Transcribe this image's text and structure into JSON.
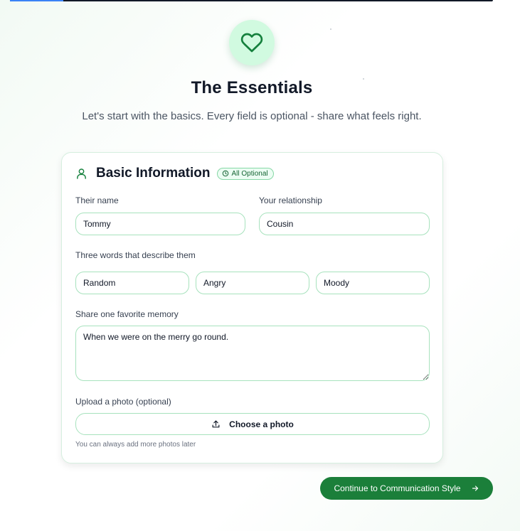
{
  "progress": {
    "fraction": 0.11
  },
  "header": {
    "icon": "heart-icon",
    "title": "The Essentials",
    "subtitle": "Let's start with the basics. Every field is optional - share what feels right."
  },
  "card": {
    "icon": "user-icon",
    "title": "Basic Information",
    "badge": "All Optional",
    "badge_icon": "clock-icon",
    "fields": {
      "name": {
        "label": "Their name",
        "value": "Tommy"
      },
      "relationship": {
        "label": "Your relationship",
        "value": "Cousin"
      },
      "words": {
        "label": "Three words that describe them",
        "values": [
          "Random",
          "Angry",
          "Moody"
        ]
      },
      "memory": {
        "label": "Share one favorite memory",
        "value": "When we were on the merry go round."
      },
      "photo": {
        "label": "Upload a photo (optional)",
        "button": "Choose a photo",
        "icon": "upload-icon",
        "hint": "You can always add more photos later"
      }
    }
  },
  "footer": {
    "continue_label": "Continue to Communication Style",
    "icon": "arrow-right-icon"
  },
  "colors": {
    "accent": "#1b7f3a",
    "border": "#a7e2bd",
    "progress": "#3b82f6"
  }
}
